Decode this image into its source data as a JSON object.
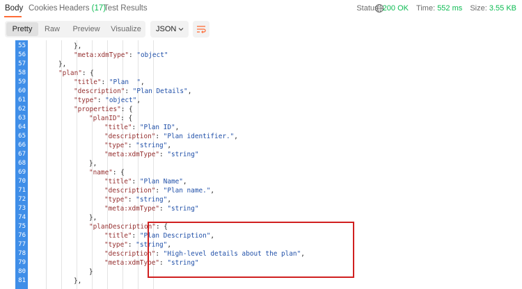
{
  "tabs": [
    {
      "label": "Body"
    },
    {
      "label": "Cookies"
    },
    {
      "label": "Headers",
      "count": "(17)"
    },
    {
      "label": "Test Results"
    }
  ],
  "status": {
    "status_label": "Status:",
    "status_value": "200 OK",
    "time_label": "Time:",
    "time_value": "552 ms",
    "size_label": "Size:",
    "size_value": "3.55 KB"
  },
  "view_modes": [
    "Pretty",
    "Raw",
    "Preview",
    "Visualize"
  ],
  "format": "JSON",
  "code_lines": [
    {
      "n": "55",
      "indent": 5,
      "tokens": [
        [
          "p",
          "},"
        ]
      ]
    },
    {
      "n": "56",
      "indent": 5,
      "tokens": [
        [
          "k",
          "\"meta:xdmType\""
        ],
        [
          "p",
          ": "
        ],
        [
          "s",
          "\"object\""
        ]
      ]
    },
    {
      "n": "57",
      "indent": 4,
      "tokens": [
        [
          "p",
          "},"
        ]
      ]
    },
    {
      "n": "58",
      "indent": 4,
      "tokens": [
        [
          "k",
          "\"plan\""
        ],
        [
          "p",
          ": {"
        ]
      ]
    },
    {
      "n": "59",
      "indent": 5,
      "tokens": [
        [
          "k",
          "\"title\""
        ],
        [
          "p",
          ": "
        ],
        [
          "s",
          "\"Plan  \""
        ],
        [
          "p",
          ","
        ]
      ]
    },
    {
      "n": "60",
      "indent": 5,
      "tokens": [
        [
          "k",
          "\"description\""
        ],
        [
          "p",
          ": "
        ],
        [
          "s",
          "\"Plan Details\""
        ],
        [
          "p",
          ","
        ]
      ]
    },
    {
      "n": "61",
      "indent": 5,
      "tokens": [
        [
          "k",
          "\"type\""
        ],
        [
          "p",
          ": "
        ],
        [
          "s",
          "\"object\""
        ],
        [
          "p",
          ","
        ]
      ]
    },
    {
      "n": "62",
      "indent": 5,
      "tokens": [
        [
          "k",
          "\"properties\""
        ],
        [
          "p",
          ": {"
        ]
      ]
    },
    {
      "n": "63",
      "indent": 6,
      "tokens": [
        [
          "k",
          "\"planID\""
        ],
        [
          "p",
          ": {"
        ]
      ]
    },
    {
      "n": "64",
      "indent": 7,
      "tokens": [
        [
          "k",
          "\"title\""
        ],
        [
          "p",
          ": "
        ],
        [
          "s",
          "\"Plan ID\""
        ],
        [
          "p",
          ","
        ]
      ]
    },
    {
      "n": "65",
      "indent": 7,
      "tokens": [
        [
          "k",
          "\"description\""
        ],
        [
          "p",
          ": "
        ],
        [
          "s",
          "\"Plan identifier.\""
        ],
        [
          "p",
          ","
        ]
      ]
    },
    {
      "n": "66",
      "indent": 7,
      "tokens": [
        [
          "k",
          "\"type\""
        ],
        [
          "p",
          ": "
        ],
        [
          "s",
          "\"string\""
        ],
        [
          "p",
          ","
        ]
      ]
    },
    {
      "n": "67",
      "indent": 7,
      "tokens": [
        [
          "k",
          "\"meta:xdmType\""
        ],
        [
          "p",
          ": "
        ],
        [
          "s",
          "\"string\""
        ]
      ]
    },
    {
      "n": "68",
      "indent": 6,
      "tokens": [
        [
          "p",
          "},"
        ]
      ]
    },
    {
      "n": "69",
      "indent": 6,
      "tokens": [
        [
          "k",
          "\"name\""
        ],
        [
          "p",
          ": {"
        ]
      ]
    },
    {
      "n": "70",
      "indent": 7,
      "tokens": [
        [
          "k",
          "\"title\""
        ],
        [
          "p",
          ": "
        ],
        [
          "s",
          "\"Plan Name\""
        ],
        [
          "p",
          ","
        ]
      ]
    },
    {
      "n": "71",
      "indent": 7,
      "tokens": [
        [
          "k",
          "\"description\""
        ],
        [
          "p",
          ": "
        ],
        [
          "s",
          "\"Plan name.\""
        ],
        [
          "p",
          ","
        ]
      ]
    },
    {
      "n": "72",
      "indent": 7,
      "tokens": [
        [
          "k",
          "\"type\""
        ],
        [
          "p",
          ": "
        ],
        [
          "s",
          "\"string\""
        ],
        [
          "p",
          ","
        ]
      ]
    },
    {
      "n": "73",
      "indent": 7,
      "tokens": [
        [
          "k",
          "\"meta:xdmType\""
        ],
        [
          "p",
          ": "
        ],
        [
          "s",
          "\"string\""
        ]
      ]
    },
    {
      "n": "74",
      "indent": 6,
      "tokens": [
        [
          "p",
          "},"
        ]
      ]
    },
    {
      "n": "75",
      "indent": 6,
      "tokens": [
        [
          "k",
          "\"planDescription\""
        ],
        [
          "p",
          ": {"
        ]
      ]
    },
    {
      "n": "76",
      "indent": 7,
      "tokens": [
        [
          "k",
          "\"title\""
        ],
        [
          "p",
          ": "
        ],
        [
          "s",
          "\"Plan Description\""
        ],
        [
          "p",
          ","
        ]
      ]
    },
    {
      "n": "77",
      "indent": 7,
      "tokens": [
        [
          "k",
          "\"type\""
        ],
        [
          "p",
          ": "
        ],
        [
          "s",
          "\"string\""
        ],
        [
          "p",
          ","
        ]
      ]
    },
    {
      "n": "78",
      "indent": 7,
      "tokens": [
        [
          "k",
          "\"description\""
        ],
        [
          "p",
          ": "
        ],
        [
          "s",
          "\"High-level details about the plan\""
        ],
        [
          "p",
          ","
        ]
      ]
    },
    {
      "n": "79",
      "indent": 7,
      "tokens": [
        [
          "k",
          "\"meta:xdmType\""
        ],
        [
          "p",
          ": "
        ],
        [
          "s",
          "\"string\""
        ]
      ]
    },
    {
      "n": "80",
      "indent": 6,
      "tokens": [
        [
          "p",
          "}"
        ]
      ]
    },
    {
      "n": "81",
      "indent": 5,
      "tokens": [
        [
          "p",
          "},"
        ]
      ]
    }
  ],
  "colors": {
    "accent": "#ff6c37",
    "success": "#0cbb52",
    "gutter": "#3f8ee8",
    "highlight_border": "#d01f1f"
  }
}
